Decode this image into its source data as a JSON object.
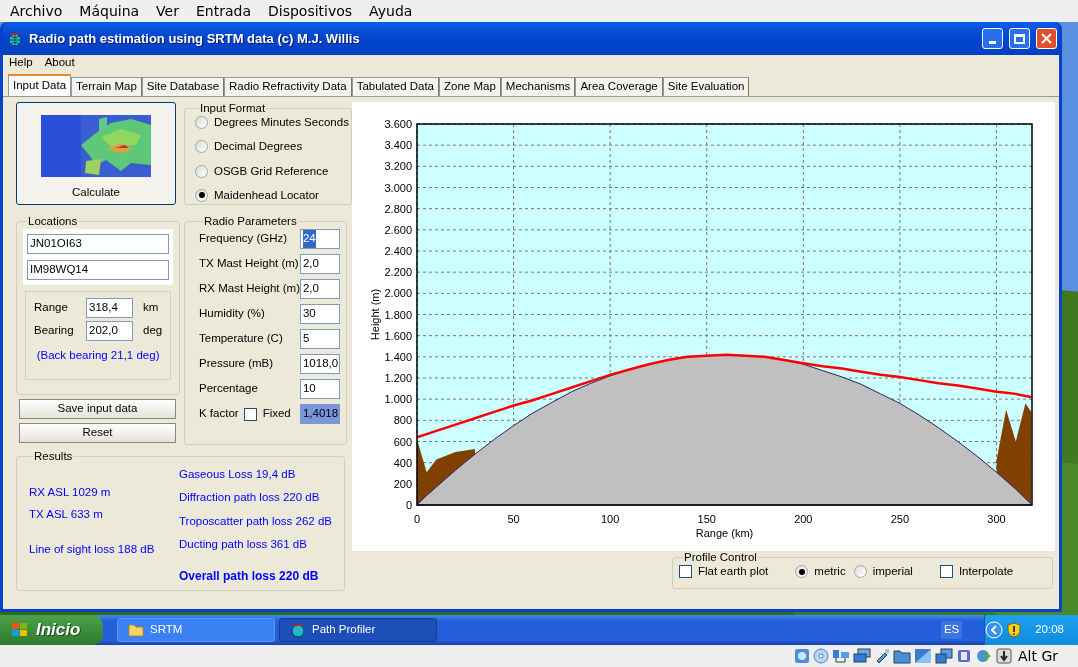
{
  "host_menu": [
    "Archivo",
    "Máquina",
    "Ver",
    "Entrada",
    "Dispositivos",
    "Ayuda"
  ],
  "window": {
    "title": "Radio path estimation using SRTM data (c) M.J. Willis",
    "menu": [
      "Help",
      "About"
    ],
    "tabs": [
      {
        "label": "Input Data",
        "selected": true
      },
      {
        "label": "Terrain Map",
        "selected": false
      },
      {
        "label": "Site Database",
        "selected": false
      },
      {
        "label": "Radio Refractivity Data",
        "selected": false
      },
      {
        "label": "Tabulated Data",
        "selected": false
      },
      {
        "label": "Zone Map",
        "selected": false
      },
      {
        "label": "Mechanisms",
        "selected": false
      },
      {
        "label": "Area Coverage",
        "selected": false
      },
      {
        "label": "Site Evaluation",
        "selected": false
      }
    ]
  },
  "calculate_button": "Calculate",
  "input_format": {
    "title": "Input Format",
    "options": [
      {
        "label": "Degrees Minutes Seconds",
        "selected": false
      },
      {
        "label": "Decimal Degrees",
        "selected": false
      },
      {
        "label": "OSGB Grid Reference",
        "selected": false
      },
      {
        "label": "Maidenhead Locator",
        "selected": true
      }
    ]
  },
  "locations": {
    "title": "Locations",
    "fields": [
      "JN01OI63",
      "IM98WQ14"
    ],
    "range": {
      "label": "Range",
      "value": "318,4",
      "unit": "km"
    },
    "bearing": {
      "label": "Bearing",
      "value": "202,0",
      "unit": "deg"
    },
    "back_bearing": "(Back bearing 21,1 deg)"
  },
  "buttons": [
    "Save input data",
    "Reset"
  ],
  "radio_parameters": {
    "title": "Radio Parameters",
    "rows": [
      {
        "label": "Frequency (GHz)",
        "value": "24",
        "highlighted": true
      },
      {
        "label": "TX Mast Height (m)",
        "value": "2,0",
        "highlighted": false
      },
      {
        "label": "RX Mast Height (m)",
        "value": "2,0",
        "highlighted": false
      },
      {
        "label": "Humidity (%)",
        "value": "30",
        "highlighted": false
      },
      {
        "label": "Temperature (C)",
        "value": "5",
        "highlighted": false
      },
      {
        "label": "Pressure (mB)",
        "value": "1018,0",
        "highlighted": false
      },
      {
        "label": "Percentage",
        "value": "10",
        "highlighted": false
      }
    ],
    "k_factor": {
      "label": "K factor",
      "fixed_label": "Fixed",
      "checked": false,
      "value": "1,4018"
    }
  },
  "results": {
    "title": "Results",
    "left": [
      "RX ASL 1029 m",
      "TX ASL 633 m",
      "Line of sight loss 188 dB"
    ],
    "right": [
      "Gaseous Loss 19,4 dB",
      "Diffraction path loss 220 dB",
      "Troposcatter path loss 262 dB",
      "Ducting path loss 361 dB"
    ],
    "overall": "Overall path loss 220 dB"
  },
  "profile_chart": {
    "chart_data": {
      "type": "area",
      "xlabel": "Range (km)",
      "ylabel": "Height (m)",
      "grid": true,
      "xlim": [
        0,
        318.4
      ],
      "ylim": [
        0,
        3600
      ],
      "xticks": [
        0,
        50,
        100,
        150,
        200,
        250,
        300
      ],
      "yticks": [
        {
          "value": 0,
          "label": "0"
        },
        {
          "value": 200,
          "label": "200"
        },
        {
          "value": 400,
          "label": "400"
        },
        {
          "value": 600,
          "label": "600"
        },
        {
          "value": 800,
          "label": "800"
        },
        {
          "value": 1000,
          "label": "1.000"
        },
        {
          "value": 1200,
          "label": "1.200"
        },
        {
          "value": 1400,
          "label": "1.400"
        },
        {
          "value": 1600,
          "label": "1.600"
        },
        {
          "value": 1800,
          "label": "1.800"
        },
        {
          "value": 2000,
          "label": "2.000"
        },
        {
          "value": 2200,
          "label": "2.200"
        },
        {
          "value": 2400,
          "label": "2.400"
        },
        {
          "value": 2600,
          "label": "2.600"
        },
        {
          "value": 2800,
          "label": "2.800"
        },
        {
          "value": 3000,
          "label": "3.000"
        },
        {
          "value": 3200,
          "label": "3.200"
        },
        {
          "value": 3400,
          "label": "3.400"
        },
        {
          "value": 3600,
          "label": "3.600"
        }
      ],
      "x": [
        0,
        5,
        10,
        20,
        30,
        40,
        50,
        60,
        70,
        80,
        90,
        100,
        110,
        120,
        130,
        140,
        150,
        160,
        170,
        180,
        190,
        200,
        210,
        220,
        230,
        240,
        250,
        260,
        270,
        280,
        290,
        300,
        305,
        310,
        315,
        318
      ],
      "series": [
        {
          "type": "area",
          "color": "#804000",
          "values": [
            620,
            310,
            430,
            500,
            530,
            null,
            null,
            null,
            null,
            null,
            null,
            null,
            null,
            null,
            null,
            null,
            null,
            null,
            null,
            null,
            null,
            null,
            null,
            null,
            null,
            null,
            null,
            null,
            null,
            null,
            null,
            420,
            900,
            600,
            960,
            880
          ]
        },
        {
          "type": "area",
          "color": "#c0c0c0",
          "values": [
            0,
            90,
            170,
            330,
            480,
            620,
            750,
            870,
            970,
            1070,
            1150,
            1220,
            1280,
            1330,
            1370,
            1400,
            1410,
            1420,
            1410,
            1400,
            1370,
            1330,
            1270,
            1210,
            1140,
            1050,
            960,
            850,
            730,
            600,
            460,
            310,
            230,
            150,
            60,
            10
          ]
        },
        {
          "type": "line",
          "color": "#ff0000",
          "values": [
            640,
            670,
            700,
            760,
            820,
            880,
            940,
            990,
            1050,
            1110,
            1170,
            1230,
            1280,
            1330,
            1370,
            1400,
            1410,
            1420,
            1410,
            1400,
            1370,
            1340,
            1310,
            1290,
            1260,
            1230,
            1210,
            1180,
            1150,
            1130,
            1100,
            1070,
            1060,
            1050,
            1030,
            1020
          ]
        }
      ]
    }
  },
  "profile_control": {
    "title": "Profile Control",
    "flat_earth": {
      "label": "Flat earth plot",
      "checked": false
    },
    "units": [
      {
        "label": "metric",
        "selected": true
      },
      {
        "label": "imperial",
        "selected": false
      }
    ],
    "interpolate": {
      "label": "Interpolate",
      "checked": false
    }
  },
  "taskbar": {
    "start": "Inicio",
    "tasks": [
      {
        "label": "SRTM",
        "kind": "folder",
        "selected": false
      },
      {
        "label": "Path Profiler",
        "kind": "app",
        "selected": true
      }
    ],
    "language": "ES",
    "clock": "20:08"
  },
  "vm_status": {
    "keyboard": "Alt Gr"
  }
}
